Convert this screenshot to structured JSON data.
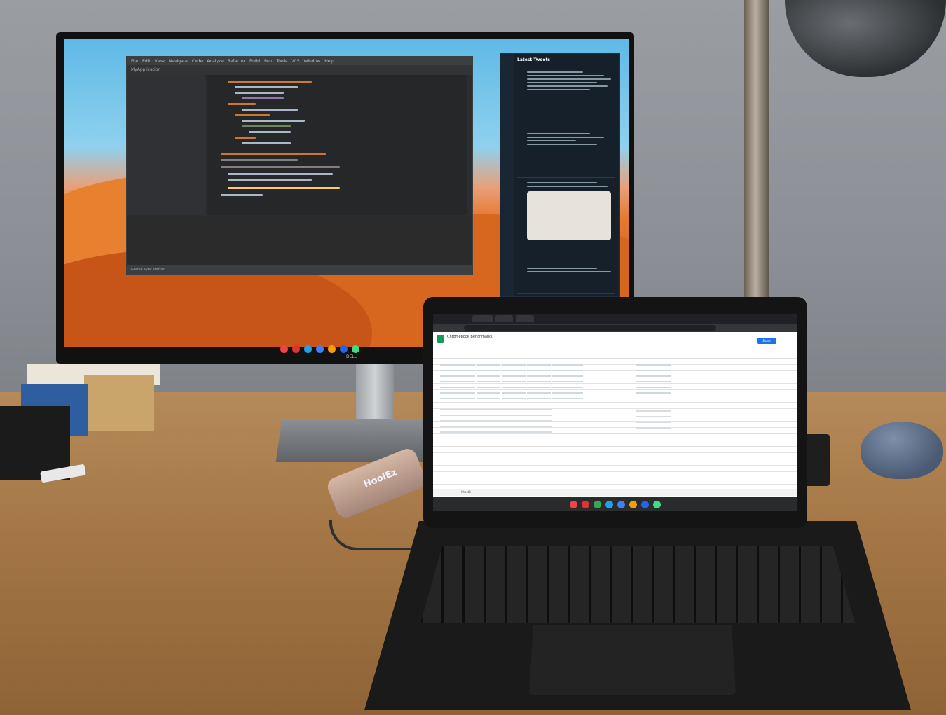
{
  "scene": {
    "hub_logo": "HoolEz",
    "monitor_brand": "DELL"
  },
  "ide": {
    "menu": [
      "File",
      "Edit",
      "View",
      "Navigate",
      "Code",
      "Analyze",
      "Refactor",
      "Build",
      "Run",
      "Tools",
      "VCS",
      "Window",
      "Help"
    ],
    "project": "MyApplication",
    "status": "Gradle sync started"
  },
  "twitter": {
    "header": "Latest Tweets"
  },
  "laptop": {
    "sheet_title": "Chromebook Benchmarks",
    "share_label": "Share",
    "sheet_tab": "Sheet1"
  }
}
